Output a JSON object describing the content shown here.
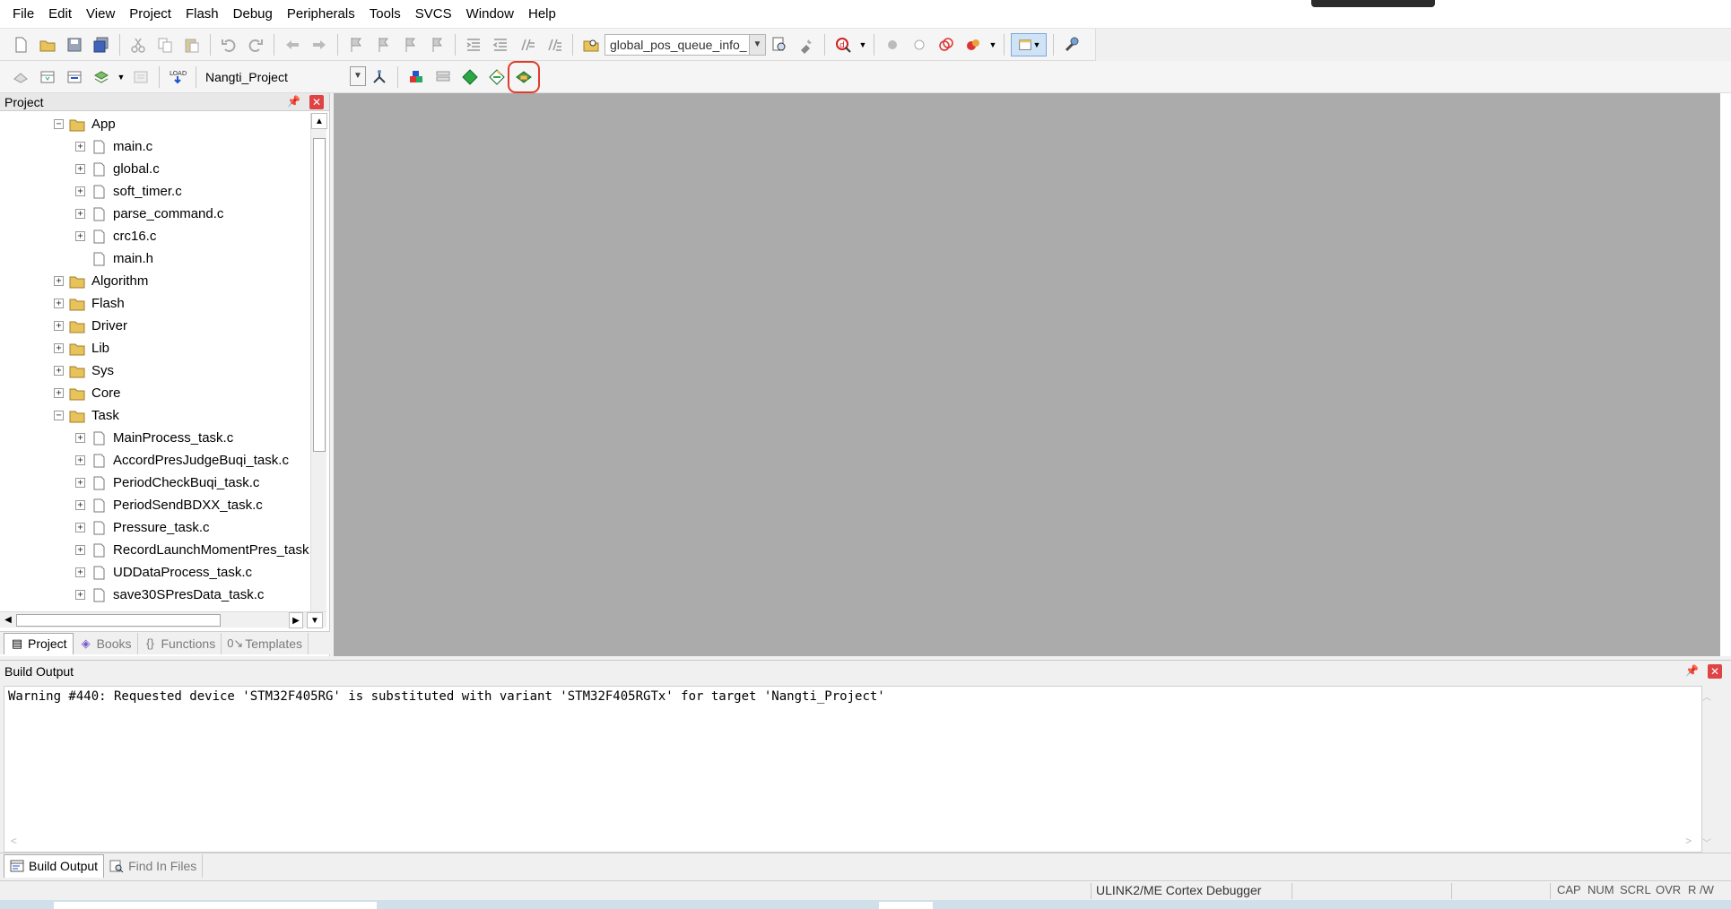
{
  "menu": [
    "File",
    "Edit",
    "View",
    "Project",
    "Flash",
    "Debug",
    "Peripherals",
    "Tools",
    "SVCS",
    "Window",
    "Help"
  ],
  "toolbar": {
    "find_combo_value": "global_pos_queue_info_",
    "target_combo_value": "Nangti_Project"
  },
  "project_panel": {
    "title": "Project",
    "tree": [
      {
        "label": "App",
        "type": "folder",
        "level": 0,
        "expander": "minus"
      },
      {
        "label": "main.c",
        "type": "file",
        "level": 1,
        "expander": "plus"
      },
      {
        "label": "global.c",
        "type": "file",
        "level": 1,
        "expander": "plus"
      },
      {
        "label": "soft_timer.c",
        "type": "file",
        "level": 1,
        "expander": "plus"
      },
      {
        "label": "parse_command.c",
        "type": "file",
        "level": 1,
        "expander": "plus"
      },
      {
        "label": "crc16.c",
        "type": "file",
        "level": 1,
        "expander": "plus"
      },
      {
        "label": "main.h",
        "type": "file",
        "level": 1,
        "expander": "none"
      },
      {
        "label": "Algorithm",
        "type": "folder",
        "level": 0,
        "expander": "plus"
      },
      {
        "label": "Flash",
        "type": "folder",
        "level": 0,
        "expander": "plus"
      },
      {
        "label": "Driver",
        "type": "folder",
        "level": 0,
        "expander": "plus"
      },
      {
        "label": "Lib",
        "type": "folder",
        "level": 0,
        "expander": "plus"
      },
      {
        "label": "Sys",
        "type": "folder",
        "level": 0,
        "expander": "plus"
      },
      {
        "label": "Core",
        "type": "folder",
        "level": 0,
        "expander": "plus"
      },
      {
        "label": "Task",
        "type": "folder",
        "level": 0,
        "expander": "minus"
      },
      {
        "label": "MainProcess_task.c",
        "type": "file",
        "level": 1,
        "expander": "plus"
      },
      {
        "label": "AccordPresJudgeBuqi_task.c",
        "type": "file",
        "level": 1,
        "expander": "plus"
      },
      {
        "label": "PeriodCheckBuqi_task.c",
        "type": "file",
        "level": 1,
        "expander": "plus"
      },
      {
        "label": "PeriodSendBDXX_task.c",
        "type": "file",
        "level": 1,
        "expander": "plus"
      },
      {
        "label": "Pressure_task.c",
        "type": "file",
        "level": 1,
        "expander": "plus"
      },
      {
        "label": "RecordLaunchMomentPres_task",
        "type": "file",
        "level": 1,
        "expander": "plus"
      },
      {
        "label": "UDDataProcess_task.c",
        "type": "file",
        "level": 1,
        "expander": "plus"
      },
      {
        "label": "save30SPresData_task.c",
        "type": "file",
        "level": 1,
        "expander": "plus"
      }
    ],
    "tabs": [
      {
        "label": "Project",
        "icon": "project-icon",
        "glyph": "▤"
      },
      {
        "label": "Books",
        "icon": "books-icon",
        "glyph": "◈"
      },
      {
        "label": "Functions",
        "icon": "functions-icon",
        "glyph": "{}"
      },
      {
        "label": "Templates",
        "icon": "templates-icon",
        "glyph": "0↘"
      }
    ]
  },
  "build_output": {
    "title": "Build Output",
    "text": "Warning #440: Requested device 'STM32F405RG' is substituted with variant 'STM32F405RGTx' for target 'Nangti_Project'",
    "tabs": [
      {
        "label": "Build Output",
        "icon": "build-output-icon"
      },
      {
        "label": "Find In Files",
        "icon": "find-in-files-icon"
      }
    ]
  },
  "status": {
    "debugger": "ULINK2/ME Cortex Debugger",
    "indicators": [
      "CAP",
      "NUM",
      "SCRL",
      "OVR",
      "R /W"
    ]
  },
  "colors": {
    "highlight": "#e03c2d",
    "editor_bg": "#ababab",
    "folder": "#e8c25a",
    "close_button": "#e04343"
  }
}
